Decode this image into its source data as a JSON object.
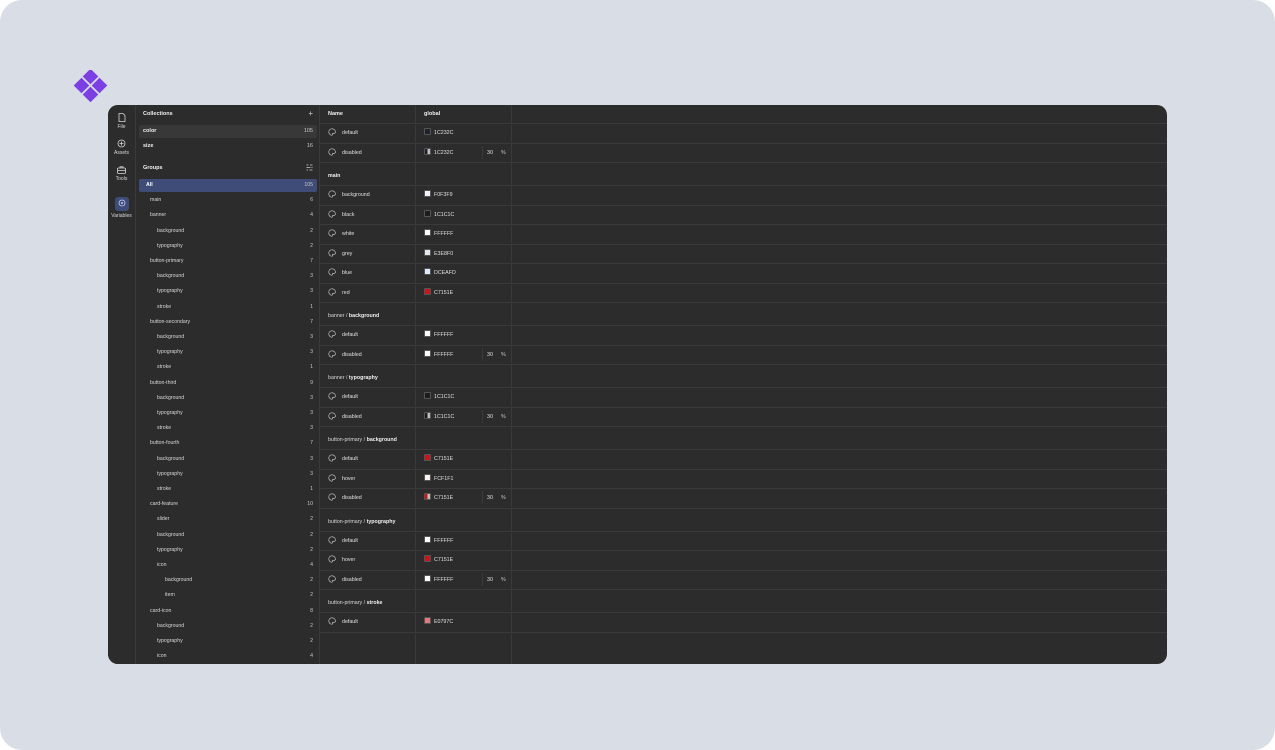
{
  "rail": [
    {
      "label": "File",
      "icon": "file-icon"
    },
    {
      "label": "Assets",
      "icon": "assets-icon"
    },
    {
      "label": "Tools",
      "icon": "tools-icon"
    },
    {
      "label": "Variables",
      "icon": "variables-icon"
    }
  ],
  "collections": {
    "title": "Collections",
    "add": "+",
    "items": [
      {
        "label": "color",
        "count": "105"
      },
      {
        "label": "size",
        "count": "16"
      }
    ]
  },
  "groups": {
    "title": "Groups",
    "items": [
      {
        "label": "All",
        "count": "105",
        "level": 0
      },
      {
        "label": "main",
        "count": "6",
        "level": 1
      },
      {
        "label": "banner",
        "count": "4",
        "level": 1
      },
      {
        "label": "background",
        "count": "2",
        "level": 2
      },
      {
        "label": "typography",
        "count": "2",
        "level": 2
      },
      {
        "label": "button-primary",
        "count": "7",
        "level": 1
      },
      {
        "label": "background",
        "count": "3",
        "level": 2
      },
      {
        "label": "typography",
        "count": "3",
        "level": 2
      },
      {
        "label": "stroke",
        "count": "1",
        "level": 2
      },
      {
        "label": "button-secondary",
        "count": "7",
        "level": 1
      },
      {
        "label": "background",
        "count": "3",
        "level": 2
      },
      {
        "label": "typography",
        "count": "3",
        "level": 2
      },
      {
        "label": "stroke",
        "count": "1",
        "level": 2
      },
      {
        "label": "button-third",
        "count": "9",
        "level": 1
      },
      {
        "label": "background",
        "count": "3",
        "level": 2
      },
      {
        "label": "typography",
        "count": "3",
        "level": 2
      },
      {
        "label": "stroke",
        "count": "3",
        "level": 2
      },
      {
        "label": "button-fourth",
        "count": "7",
        "level": 1
      },
      {
        "label": "background",
        "count": "3",
        "level": 2
      },
      {
        "label": "typography",
        "count": "3",
        "level": 2
      },
      {
        "label": "stroke",
        "count": "1",
        "level": 2
      },
      {
        "label": "card-feature",
        "count": "10",
        "level": 1
      },
      {
        "label": "slider",
        "count": "2",
        "level": 2
      },
      {
        "label": "background",
        "count": "2",
        "level": 2
      },
      {
        "label": "typography",
        "count": "2",
        "level": 2
      },
      {
        "label": "icon",
        "count": "4",
        "level": 2
      },
      {
        "label": "background",
        "count": "2",
        "level": 3
      },
      {
        "label": "item",
        "count": "2",
        "level": 3
      },
      {
        "label": "card-icon",
        "count": "8",
        "level": 1
      },
      {
        "label": "background",
        "count": "2",
        "level": 2
      },
      {
        "label": "typography",
        "count": "2",
        "level": 2
      },
      {
        "label": "icon",
        "count": "4",
        "level": 2
      }
    ]
  },
  "table": {
    "col_name": "Name",
    "col_mode": "global",
    "sections": [
      {
        "prefix": "",
        "name": "",
        "rows": [
          {
            "name": "default",
            "color": "#1C232C",
            "hex": "1C232C"
          },
          {
            "name": "disabled",
            "color": "#1C232C",
            "hex": "1C232C",
            "opacity": "30",
            "alpha": true
          }
        ]
      },
      {
        "prefix": "",
        "name": "main",
        "rows": [
          {
            "name": "background",
            "color": "#F0F3F9",
            "hex": "F0F3F9"
          },
          {
            "name": "black",
            "color": "#1C1C1C",
            "hex": "1C1C1C"
          },
          {
            "name": "white",
            "color": "#FFFFFF",
            "hex": "FFFFFF"
          },
          {
            "name": "grey",
            "color": "#E3E8F0",
            "hex": "E3E8F0"
          },
          {
            "name": "blue",
            "color": "#DCEAFD",
            "hex": "DCEAFD"
          },
          {
            "name": "red",
            "color": "#C7151E",
            "hex": "C7151E"
          }
        ]
      },
      {
        "prefix": "banner / ",
        "name": "background",
        "rows": [
          {
            "name": "default",
            "color": "#FFFFFF",
            "hex": "FFFFFF"
          },
          {
            "name": "disabled",
            "color": "#FFFFFF",
            "hex": "FFFFFF",
            "opacity": "30"
          }
        ]
      },
      {
        "prefix": "banner / ",
        "name": "typography",
        "rows": [
          {
            "name": "default",
            "color": "#1C1C1C",
            "hex": "1C1C1C"
          },
          {
            "name": "disabled",
            "color": "#1C1C1C",
            "hex": "1C1C1C",
            "opacity": "30",
            "alpha": true
          }
        ]
      },
      {
        "prefix": "button-primary / ",
        "name": "background",
        "rows": [
          {
            "name": "default",
            "color": "#C7151E",
            "hex": "C7151E"
          },
          {
            "name": "hover",
            "color": "#FCF1F1",
            "hex": "FCF1F1"
          },
          {
            "name": "disabled",
            "color": "#C7151E",
            "hex": "C7151E",
            "opacity": "30",
            "alpha": true
          }
        ]
      },
      {
        "prefix": "button-primary / ",
        "name": "typography",
        "rows": [
          {
            "name": "default",
            "color": "#FFFFFF",
            "hex": "FFFFFF"
          },
          {
            "name": "hover",
            "color": "#C7151E",
            "hex": "C7151E"
          },
          {
            "name": "disabled",
            "color": "#FFFFFF",
            "hex": "FFFFFF",
            "opacity": "30"
          }
        ]
      },
      {
        "prefix": "button-primary / ",
        "name": "stroke",
        "rows": [
          {
            "name": "default",
            "color": "#E0797C",
            "hex": "E0797C"
          }
        ]
      }
    ]
  },
  "colors": {
    "accent": "#3f4c78",
    "brand": "#7b3fe4",
    "bg": "#2c2c2c",
    "page": "#d9dee6"
  }
}
